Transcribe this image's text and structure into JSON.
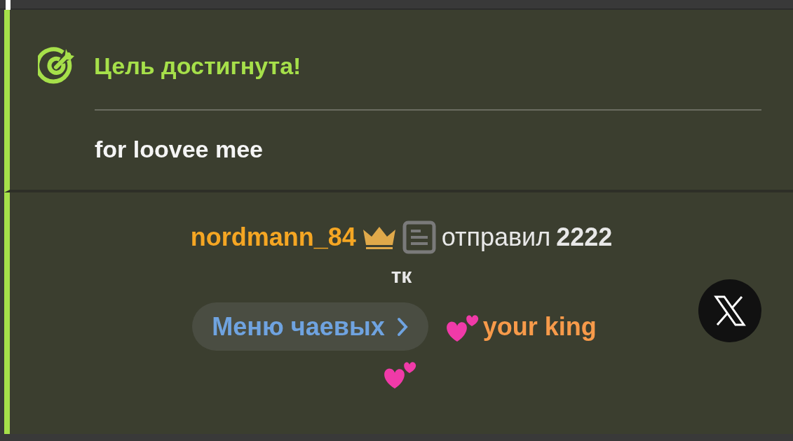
{
  "goal": {
    "title": "Цель достигнута!",
    "description": "for loovee mee"
  },
  "tip": {
    "username": "nordmann_84",
    "action": "отправил",
    "amount": "2222",
    "unit": "тк",
    "menu_button": "Меню чаевых",
    "message": "your king"
  }
}
